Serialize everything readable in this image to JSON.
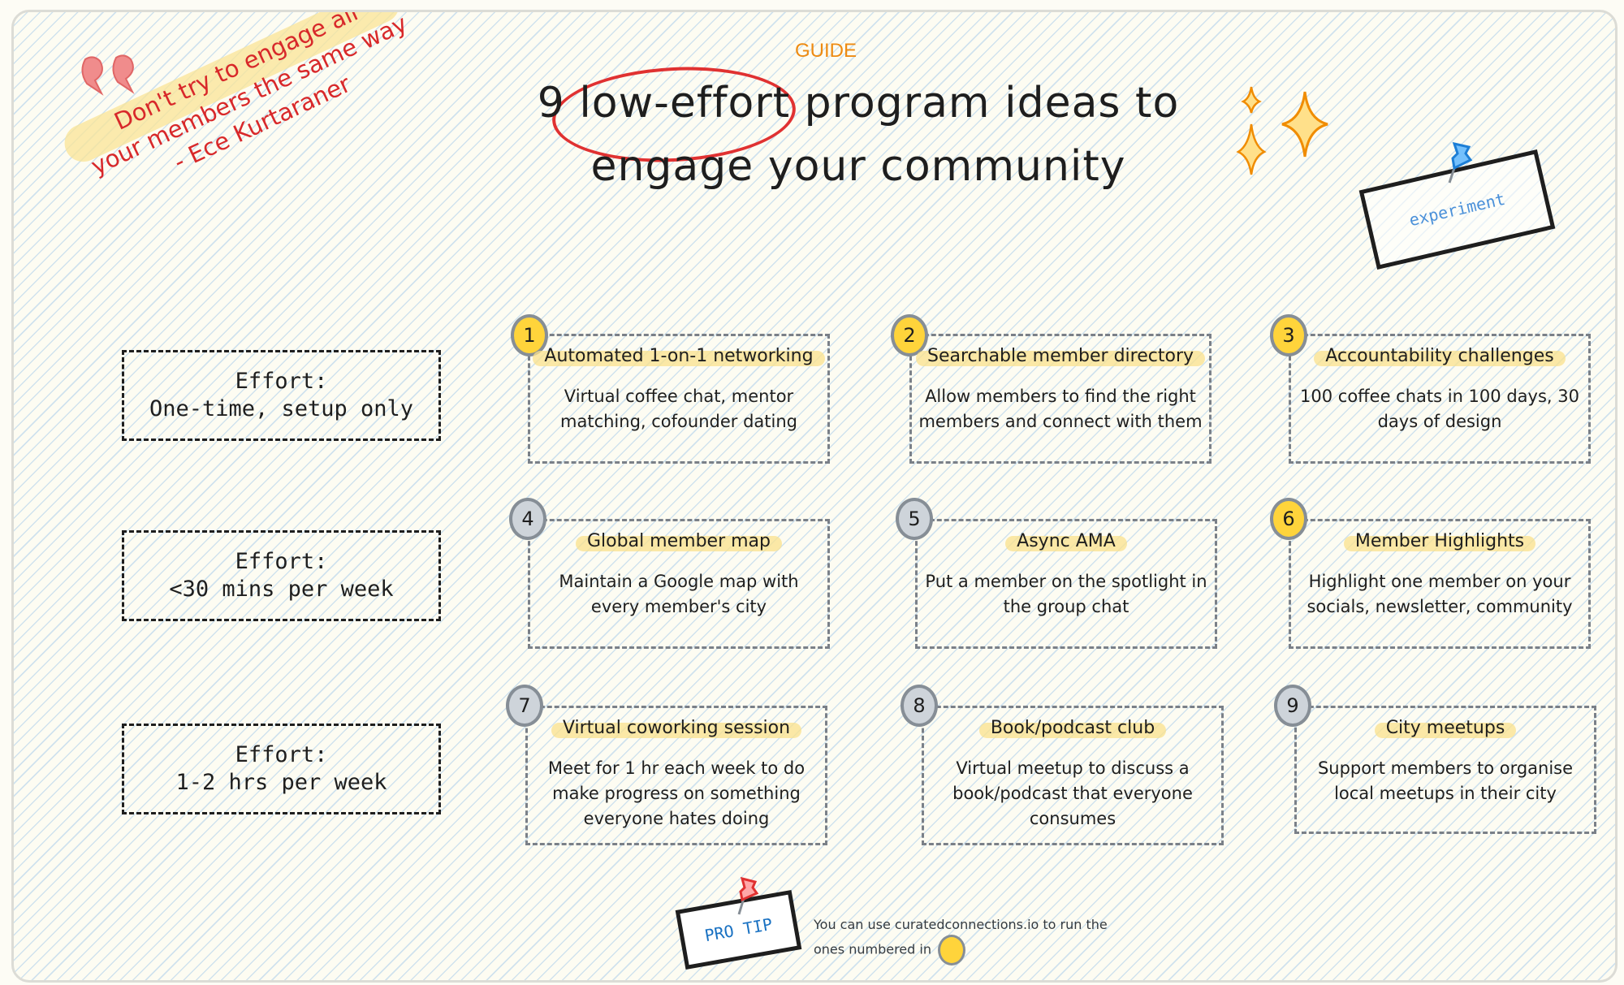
{
  "header": {
    "eyebrow": "GUIDE",
    "title_line1_prefix": "9",
    "title_line1_highlight": "low-effort",
    "title_line1_suffix": "program ideas to",
    "title_line2": "engage your community"
  },
  "quote": {
    "text_line1": "Don't try to engage all",
    "text_line2": "your members the same way",
    "author": "- Ece Kurtaraner",
    "icon": "quote-marks-icon"
  },
  "sticker": {
    "label": "experiment",
    "icon": "pushpin-icon"
  },
  "effort_levels": [
    {
      "label": "Effort:",
      "value": "One-time, setup only"
    },
    {
      "label": "Effort:",
      "value": "<30 mins per week"
    },
    {
      "label": "Effort:",
      "value": "1-2 hrs per week"
    }
  ],
  "ideas": [
    {
      "number": "1",
      "title": "Automated 1-on-1 networking",
      "description": "Virtual coffee chat, mentor matching, cofounder dating",
      "supported": true
    },
    {
      "number": "2",
      "title": "Searchable member directory",
      "description": "Allow members to find the right members and connect with them",
      "supported": true
    },
    {
      "number": "3",
      "title": "Accountability challenges",
      "description": "100 coffee chats in 100 days, 30 days of design",
      "supported": true
    },
    {
      "number": "4",
      "title": "Global member map",
      "description": "Maintain a Google map with every member's city",
      "supported": false
    },
    {
      "number": "5",
      "title": "Async AMA",
      "description": "Put a member on the spotlight in the group chat",
      "supported": false
    },
    {
      "number": "6",
      "title": "Member Highlights",
      "description": "Highlight one member on your socials, newsletter, community",
      "supported": true
    },
    {
      "number": "7",
      "title": "Virtual coworking session",
      "description": "Meet for 1 hr each week to do make progress on something everyone hates doing",
      "supported": false
    },
    {
      "number": "8",
      "title": "Book/podcast club",
      "description": "Virtual meetup to discuss a book/podcast that everyone consumes",
      "supported": false
    },
    {
      "number": "9",
      "title": "City meetups",
      "description": "Support members to organise local meetups in their city",
      "supported": false
    }
  ],
  "pro_tip": {
    "label": "PRO TIP",
    "text": "You can use curatedconnections.io to run the ones numbered in",
    "icon": "pushpin-icon"
  },
  "colors": {
    "highlight_yellow": "#ffd43b",
    "badge_grey": "#ced4da",
    "quote_red": "#d8282a",
    "guide_orange": "#ee8b12",
    "sticker_blue": "#4a90d9",
    "protip_blue": "#1971c2"
  }
}
